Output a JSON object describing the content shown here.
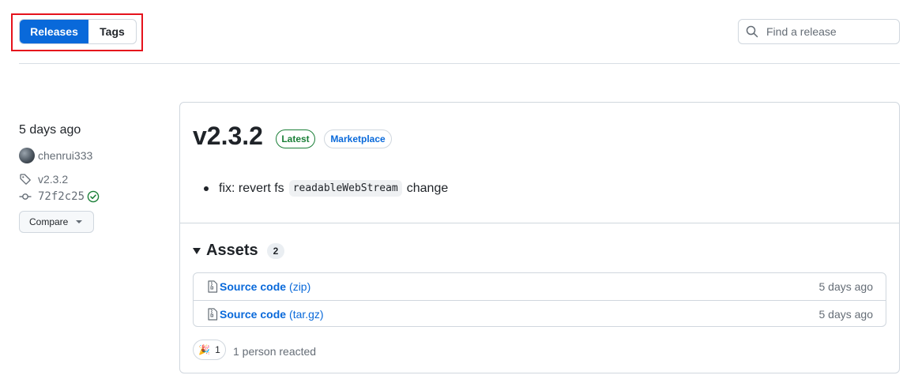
{
  "nav": {
    "releases_label": "Releases",
    "tags_label": "Tags"
  },
  "search": {
    "placeholder": "Find a release"
  },
  "release_meta": {
    "date": "5 days ago",
    "author": "chenrui333",
    "tag": "v2.3.2",
    "commit": "72f2c25",
    "compare_label": "Compare"
  },
  "release": {
    "title": "v2.3.2",
    "badges": {
      "latest": "Latest",
      "marketplace": "Marketplace"
    },
    "note": {
      "prefix": "fix: revert fs",
      "code": "readableWebStream",
      "suffix": "change"
    }
  },
  "assets": {
    "heading": "Assets",
    "count": "2",
    "items": [
      {
        "name": "Source code",
        "ext": "(zip)",
        "time": "5 days ago"
      },
      {
        "name": "Source code",
        "ext": "(tar.gz)",
        "time": "5 days ago"
      }
    ]
  },
  "reactions": {
    "emoji": "🎉",
    "count": "1",
    "text": "1 person reacted"
  },
  "colors": {
    "accent": "#0969da",
    "success": "#1a7f37",
    "highlight": "#e5121c"
  },
  "icons": [
    "search-icon",
    "tag-icon",
    "commit-icon",
    "check-circle-icon",
    "zip-file-icon",
    "caret-down-icon"
  ]
}
